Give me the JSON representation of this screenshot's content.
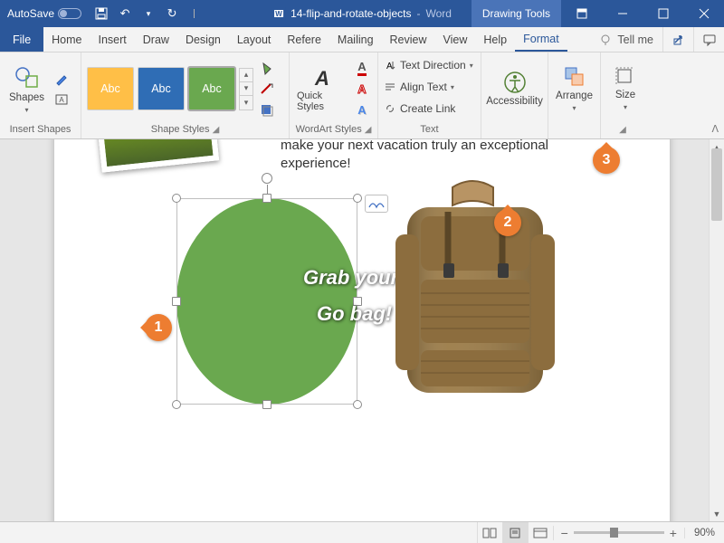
{
  "title": {
    "autosave": "AutoSave",
    "autosave_state": "Off",
    "doc": "14-flip-and-rotate-objects",
    "app": "Word",
    "tooltab": "Drawing Tools"
  },
  "tabs": {
    "file": "File",
    "home": "Home",
    "insert": "Insert",
    "draw": "Draw",
    "design": "Design",
    "layout": "Layout",
    "references": "Refere",
    "mailings": "Mailing",
    "review": "Review",
    "view": "View",
    "help": "Help",
    "format": "Format",
    "tellme": "Tell me"
  },
  "ribbon": {
    "insertshapes": {
      "label": "Insert Shapes",
      "shapes": "Shapes"
    },
    "shapestyles": {
      "label": "Shape Styles",
      "swatches": [
        "Abc",
        "Abc",
        "Abc"
      ],
      "swatch_colors": [
        "#ffbf47",
        "#2f6db5",
        "#6aa84f"
      ]
    },
    "wordart": {
      "label": "WordArt Styles",
      "quick": "Quick Styles"
    },
    "text": {
      "label": "Text",
      "direction": "Text Direction",
      "align": "Align Text",
      "link": "Create Link"
    },
    "accessibility": "Accessibility",
    "arrange": "Arrange",
    "size": "Size"
  },
  "doc": {
    "body": "make your next vacation truly an exceptional experience!",
    "wa1": "Grab your",
    "wa2": "Go bag!"
  },
  "callouts": {
    "c1": "1",
    "c2": "2",
    "c3": "3"
  },
  "status": {
    "zoom": "90%"
  }
}
